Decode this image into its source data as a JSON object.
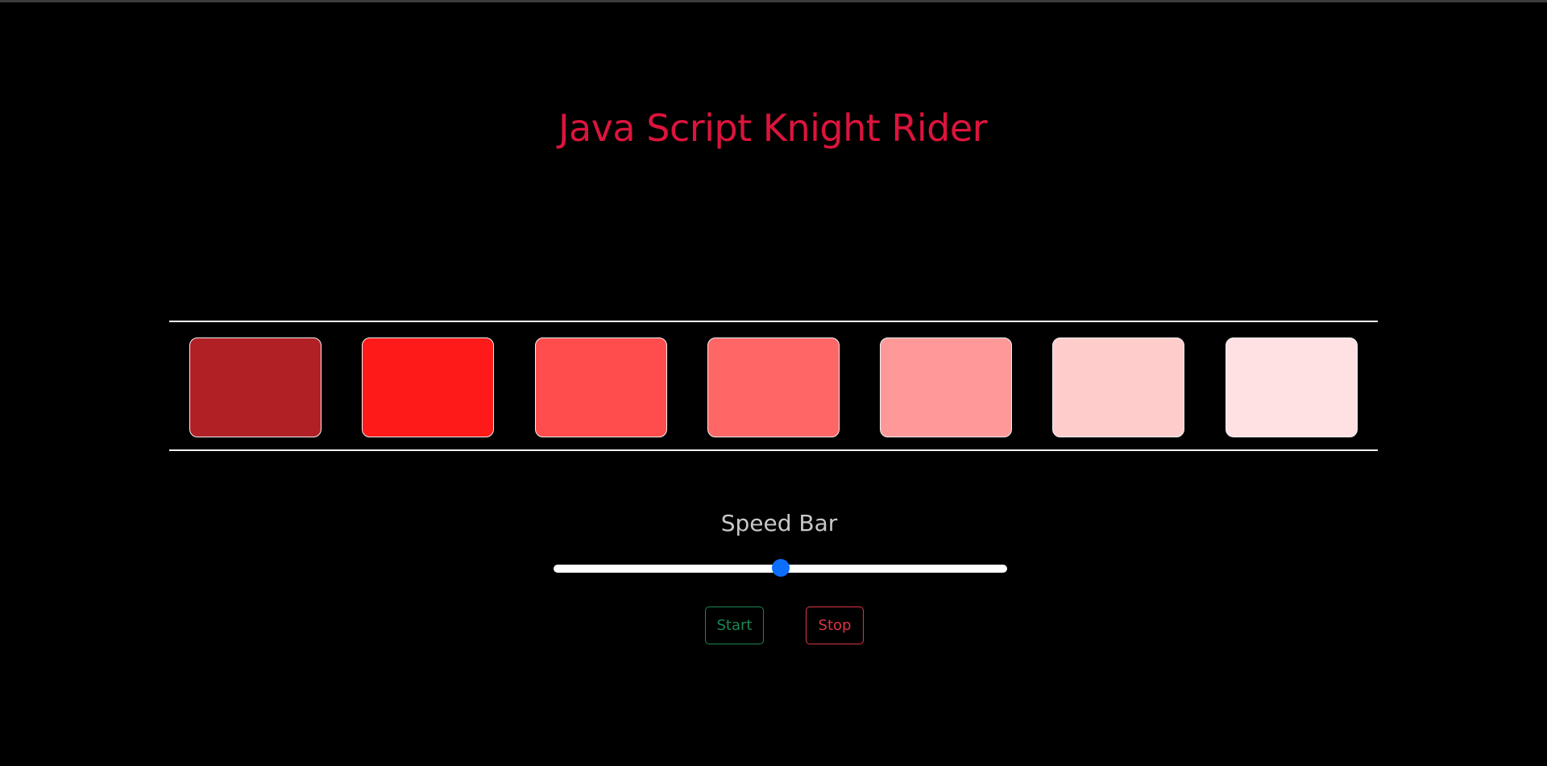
{
  "title": "Java Script Knight Rider",
  "colors": {
    "background": "#000000",
    "title": "#dc143c",
    "panel_border": "#ffffff",
    "slider_accent": "#0d6efd",
    "start": "#198754",
    "stop": "#dc3545"
  },
  "leds": [
    {
      "color": "#b02024"
    },
    {
      "color": "#ff1a1a"
    },
    {
      "color": "#ff4d4d"
    },
    {
      "color": "#ff6666"
    },
    {
      "color": "#ff9999"
    },
    {
      "color": "#ffcccc"
    },
    {
      "color": "#ffe0e3"
    }
  ],
  "speed": {
    "label": "Speed Bar",
    "value_fraction": 0.5
  },
  "buttons": {
    "start_label": "Start",
    "stop_label": "Stop"
  }
}
